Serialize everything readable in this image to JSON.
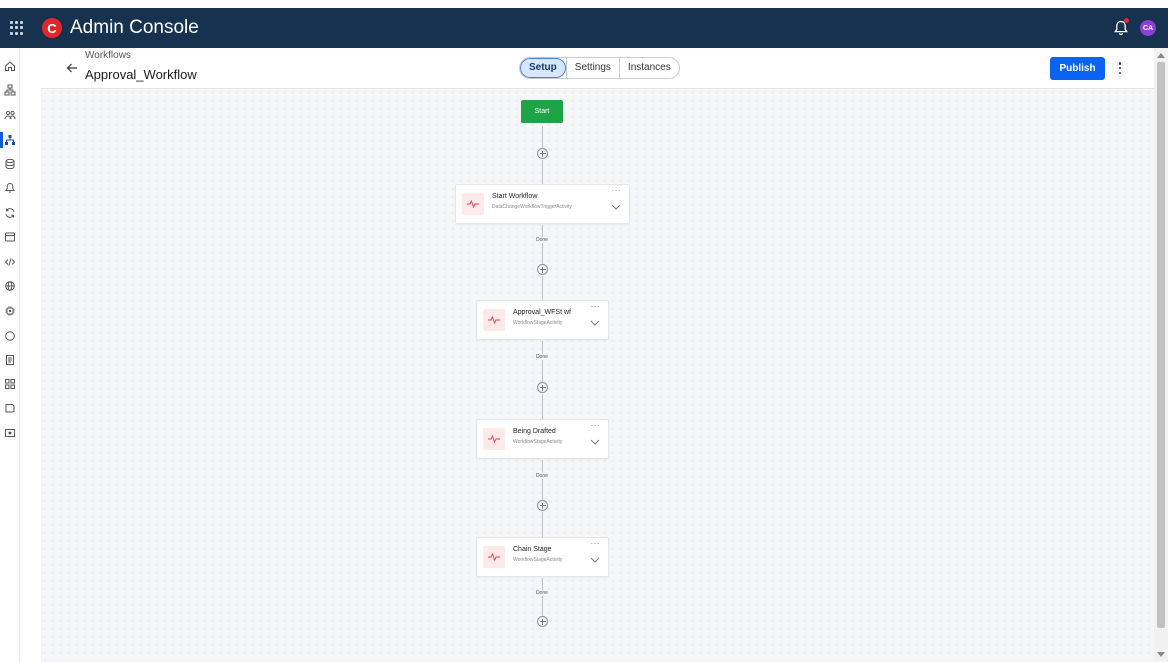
{
  "app": {
    "brand_letter": "C",
    "title": "Admin Console",
    "avatar_initials": "CA",
    "brand_color": "#e3262c",
    "topbar_color": "#16324f",
    "icons": [
      "apps-grid-icon",
      "bell-icon"
    ]
  },
  "sidebar": {
    "items": [
      {
        "icon": "home-icon"
      },
      {
        "icon": "org-chart-icon"
      },
      {
        "icon": "users-icon"
      },
      {
        "icon": "workflow-icon",
        "active": true
      },
      {
        "icon": "database-icon"
      },
      {
        "icon": "bell-icon"
      },
      {
        "icon": "sync-icon"
      },
      {
        "icon": "window-icon"
      },
      {
        "icon": "code-icon"
      },
      {
        "icon": "globe-icon"
      },
      {
        "icon": "chip-icon"
      },
      {
        "icon": "circle-icon"
      },
      {
        "icon": "document-icon"
      },
      {
        "icon": "grid-icon"
      },
      {
        "icon": "tag-icon"
      },
      {
        "icon": "image-icon"
      }
    ]
  },
  "header": {
    "breadcrumb": "Workflows",
    "title": "Approval_Workflow",
    "tabs": [
      {
        "label": "Setup",
        "active": true
      },
      {
        "label": "Settings",
        "active": false
      },
      {
        "label": "Instances",
        "active": false
      }
    ],
    "publish_label": "Publish",
    "accent_color": "#0b63f6"
  },
  "workflow": {
    "start_label": "Start",
    "start_color": "#1fa347",
    "connector_label": "Done",
    "more_label": "···",
    "nodes": [
      {
        "title": "Start Workflow",
        "subtitle": "DataChangeWorkflowTriggerActivity"
      },
      {
        "title": "Approval_WFSt wf",
        "subtitle": "WorkflowStageActivity"
      },
      {
        "title": "Being Drafted",
        "subtitle": "WorkflowStageActivity"
      },
      {
        "title": "Chain Stage",
        "subtitle": "WorkflowStageActivity"
      }
    ]
  }
}
